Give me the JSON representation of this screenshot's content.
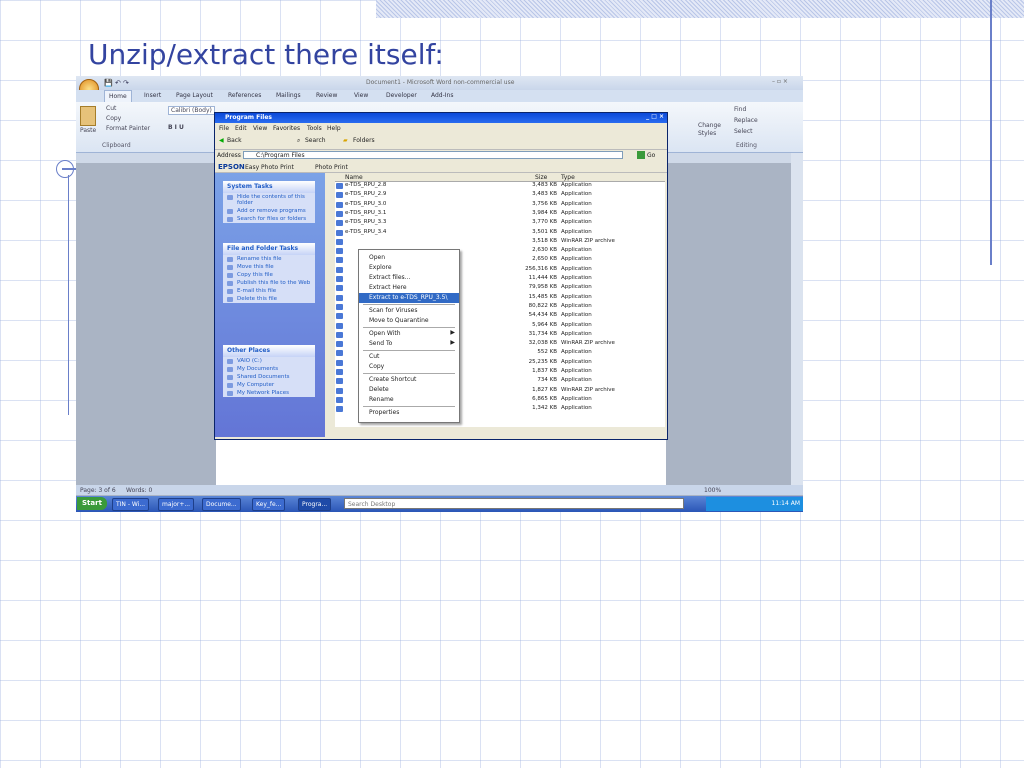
{
  "slide": {
    "title": "Unzip/extract there itself:"
  },
  "word": {
    "title": "Document1 - Microsoft Word non-commercial use",
    "tabs": [
      "Home",
      "Insert",
      "Page Layout",
      "References",
      "Mailings",
      "Review",
      "View",
      "Developer",
      "Add-Ins"
    ],
    "clipboard": {
      "cut": "Cut",
      "copy": "Copy",
      "paste": "Paste",
      "format_painter": "Format Painter",
      "group": "Clipboard"
    },
    "font": {
      "name": "Calibri (Body)"
    },
    "styles": {
      "change": "Change",
      "styles": "Styles"
    },
    "editing": {
      "find": "Find",
      "replace": "Replace",
      "select": "Select",
      "group": "Editing"
    },
    "status": {
      "page": "Page: 3 of 6",
      "words": "Words: 0",
      "zoom": "100%"
    }
  },
  "explorer": {
    "title": "Program Files",
    "menu": [
      "File",
      "Edit",
      "View",
      "Favorites",
      "Tools",
      "Help"
    ],
    "toolbar": {
      "back": "Back",
      "search": "Search",
      "folders": "Folders"
    },
    "address": {
      "label": "Address",
      "value": "C:\\Program Files",
      "go": "Go"
    },
    "epson": {
      "brand": "EPSON",
      "easy": "Easy Photo Print",
      "photo": "Photo Print"
    },
    "system_tasks": {
      "title": "System Tasks",
      "items": [
        "Hide the contents of this folder",
        "Add or remove programs",
        "Search for files or folders"
      ]
    },
    "file_tasks": {
      "title": "File and Folder Tasks",
      "items": [
        "Rename this file",
        "Move this file",
        "Copy this file",
        "Publish this file to the Web",
        "E-mail this file",
        "Delete this file"
      ]
    },
    "other_places": {
      "title": "Other Places",
      "items": [
        "VAIO (C:)",
        "My Documents",
        "Shared Documents",
        "My Computer",
        "My Network Places"
      ]
    },
    "columns": {
      "name": "Name",
      "size": "Size",
      "type": "Type"
    },
    "files": [
      {
        "name": "e-TDS_RPU_2.8",
        "size": "3,483 KB",
        "type": "Application"
      },
      {
        "name": "e-TDS_RPU_2.9",
        "size": "3,483 KB",
        "type": "Application"
      },
      {
        "name": "e-TDS_RPU_3.0",
        "size": "3,756 KB",
        "type": "Application"
      },
      {
        "name": "e-TDS_RPU_3.1",
        "size": "3,984 KB",
        "type": "Application"
      },
      {
        "name": "e-TDS_RPU_3.3",
        "size": "3,770 KB",
        "type": "Application"
      },
      {
        "name": "e-TDS_RPU_3.4",
        "size": "3,501 KB",
        "type": "Application"
      },
      {
        "name": "",
        "size": "3,518 KB",
        "type": "WinRAR ZIP archive"
      },
      {
        "name": "",
        "size": "2,630 KB",
        "type": "Application"
      },
      {
        "name": "",
        "size": "2,650 KB",
        "type": "Application"
      },
      {
        "name": "",
        "size": "256,316 KB",
        "type": "Application"
      },
      {
        "name": "",
        "size": "11,444 KB",
        "type": "Application"
      },
      {
        "name": "",
        "size": "79,958 KB",
        "type": "Application"
      },
      {
        "name": "",
        "size": "15,485 KB",
        "type": "Application"
      },
      {
        "name": "",
        "size": "80,822 KB",
        "type": "Application"
      },
      {
        "name": "",
        "size": "54,434 KB",
        "type": "Application"
      },
      {
        "name": "",
        "size": "5,964 KB",
        "type": "Application"
      },
      {
        "name": "",
        "size": "31,734 KB",
        "type": "Application"
      },
      {
        "name": "",
        "size": "32,038 KB",
        "type": "WinRAR ZIP archive"
      },
      {
        "name": "",
        "size": "552 KB",
        "type": "Application"
      },
      {
        "name": "",
        "size": "25,235 KB",
        "type": "Application"
      },
      {
        "name": "",
        "size": "1,837 KB",
        "type": "Application"
      },
      {
        "name": "",
        "size": "734 KB",
        "type": "Application"
      },
      {
        "name": "",
        "size": "1,827 KB",
        "type": "WinRAR ZIP archive"
      },
      {
        "name": "",
        "size": "6,865 KB",
        "type": "Application"
      },
      {
        "name": "",
        "size": "1,342 KB",
        "type": "Application"
      }
    ],
    "context_menu": [
      "Open",
      "Explore",
      "Extract files...",
      "Extract Here",
      "Extract to e-TDS_RPU_3.5\\",
      "Scan for Viruses",
      "Move to Quarantine",
      "Open With",
      "Send To",
      "Cut",
      "Copy",
      "Create Shortcut",
      "Delete",
      "Rename",
      "Properties"
    ]
  },
  "taskbar": {
    "start": "Start",
    "buttons": [
      "TIN - Wi...",
      "major+...",
      "Docume...",
      "Key_fe...",
      "Progra..."
    ],
    "search": "Search Desktop",
    "time": "11:14 AM"
  }
}
